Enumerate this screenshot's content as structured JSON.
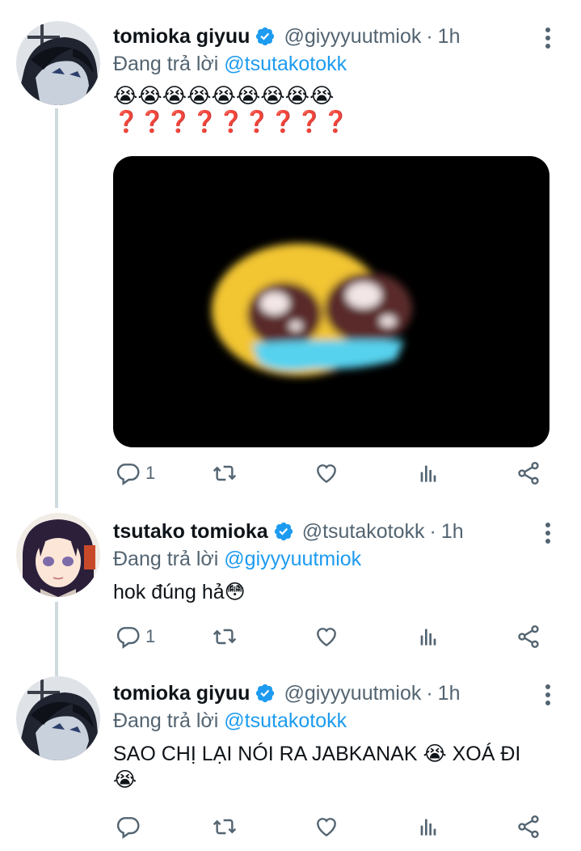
{
  "tweets": [
    {
      "name": "tomioka giyuu",
      "handle": "@giyyyuutmiok",
      "dot": "·",
      "time": "1h",
      "reply_prefix": "Đang trả lời ",
      "reply_to": "@tsutakotokk",
      "emoji_line_1": "😭😭😭😭😭😭😭😭😭",
      "emoji_line_2": "❓❓❓❓❓❓❓❓❓",
      "reply_count": "1",
      "has_media": true
    },
    {
      "name": "tsutako tomioka",
      "handle": "@tsutakotokk",
      "dot": "·",
      "time": "1h",
      "reply_prefix": "Đang trả lời ",
      "reply_to": "@giyyyuutmiok",
      "text": "hok đúng hả😳",
      "reply_count": "1"
    },
    {
      "name": "tomioka giyuu",
      "handle": "@giyyyuutmiok",
      "dot": "·",
      "time": "1h",
      "reply_prefix": "Đang trả lời ",
      "reply_to": "@tsutakotokk",
      "text": "SAO CHỊ LẠI NÓI RA JABKANAK 😭 XOÁ ĐI\n😭",
      "reply_count": ""
    }
  ],
  "icons": {
    "verified": "verified-badge-icon",
    "reply": "reply-icon",
    "retweet": "retweet-icon",
    "like": "heart-icon",
    "views": "views-icon",
    "share": "share-icon",
    "more": "more-vertical-icon"
  },
  "colors": {
    "accent": "#1d9bf0",
    "muted": "#536471",
    "thread_line": "#cfd9de",
    "text": "#0f1419"
  }
}
